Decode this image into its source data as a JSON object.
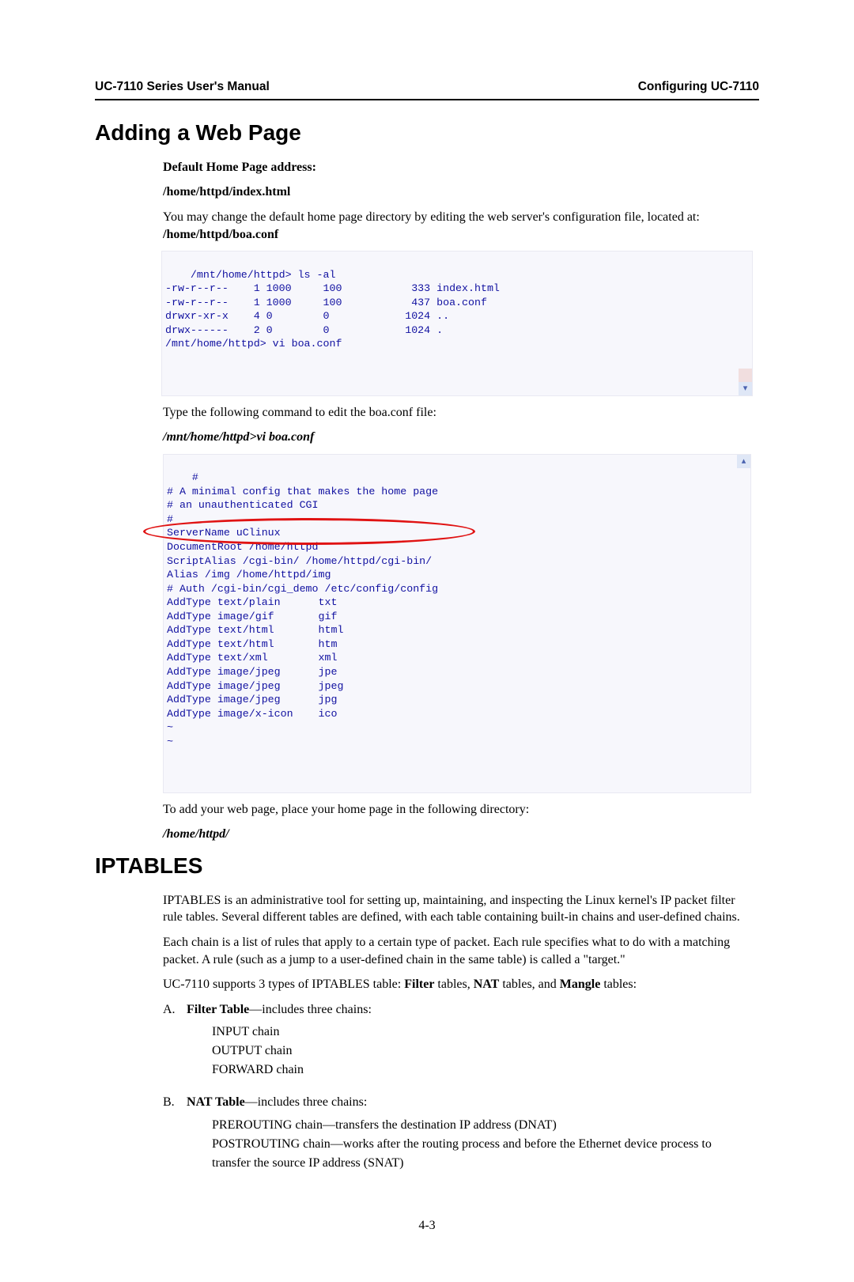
{
  "header": {
    "left": "UC-7110 Series User's Manual",
    "right": "Configuring UC-7110"
  },
  "h1": "Adding a Web Page",
  "sub1": "Default Home Page address:",
  "sub2": "/home/httpd/index.html",
  "para1_a": "You may change the default home page directory by editing the web server's configuration file, located at: ",
  "para1_b": "/home/httpd/boa.conf",
  "terminal1": "/mnt/home/httpd> ls -al\n-rw-r--r--    1 1000     100           333 index.html\n-rw-r--r--    1 1000     100           437 boa.conf\ndrwxr-xr-x    4 0        0            1024 ..\ndrwx------    2 0        0            1024 .\n/mnt/home/httpd> vi boa.conf",
  "para2": "Type the following command to edit the boa.conf file:",
  "cmd1": "/mnt/home/httpd>vi boa.conf",
  "terminal2": "#\n# A minimal config that makes the home page\n# an unauthenticated CGI\n#\nServerName uClinux\nDocumentRoot /home/httpd\nScriptAlias /cgi-bin/ /home/httpd/cgi-bin/\nAlias /img /home/httpd/img\n# Auth /cgi-bin/cgi_demo /etc/config/config\nAddType text/plain      txt\nAddType image/gif       gif\nAddType text/html       html\nAddType text/html       htm\nAddType text/xml        xml\nAddType image/jpeg      jpe\nAddType image/jpeg      jpeg\nAddType image/jpeg      jpg\nAddType image/x-icon    ico\n~\n~",
  "para3": "To add your web page, place your home page in the following directory:",
  "dir1": "/home/httpd/",
  "h2": "IPTABLES",
  "iptables_intro": "IPTABLES is an administrative tool for setting up, maintaining, and inspecting the Linux kernel's IP packet filter rule tables. Several different tables are defined, with each table containing built-in chains and user-defined chains.",
  "iptables_p2": "Each chain is a list of rules that apply to a certain type of packet. Each rule specifies what to do with a matching packet. A rule (such as a jump to a user-defined chain in the same table) is called a \"target.\"",
  "iptables_p3_a": "UC-7110 supports 3 types of IPTABLES table: ",
  "iptables_p3_b": "Filter",
  "iptables_p3_c": " tables, ",
  "iptables_p3_d": "NAT",
  "iptables_p3_e": " tables, and ",
  "iptables_p3_f": "Mangle",
  "iptables_p3_g": " tables:",
  "list": {
    "A": {
      "label": "A.",
      "title": "Filter Table",
      "tail": "—includes three chains:",
      "lines": [
        "INPUT chain",
        "OUTPUT chain",
        "FORWARD chain"
      ]
    },
    "B": {
      "label": "B.",
      "title": "NAT Table",
      "tail": "—includes three chains:",
      "lines": [
        "PREROUTING chain—transfers the destination IP address (DNAT)",
        "POSTROUTING chain—works after the routing process and before the Ethernet device process to transfer the source IP address (SNAT)"
      ]
    }
  },
  "pagefoot": "4-3",
  "icons": {
    "scroll_up": "▴",
    "scroll_down": "▾"
  }
}
